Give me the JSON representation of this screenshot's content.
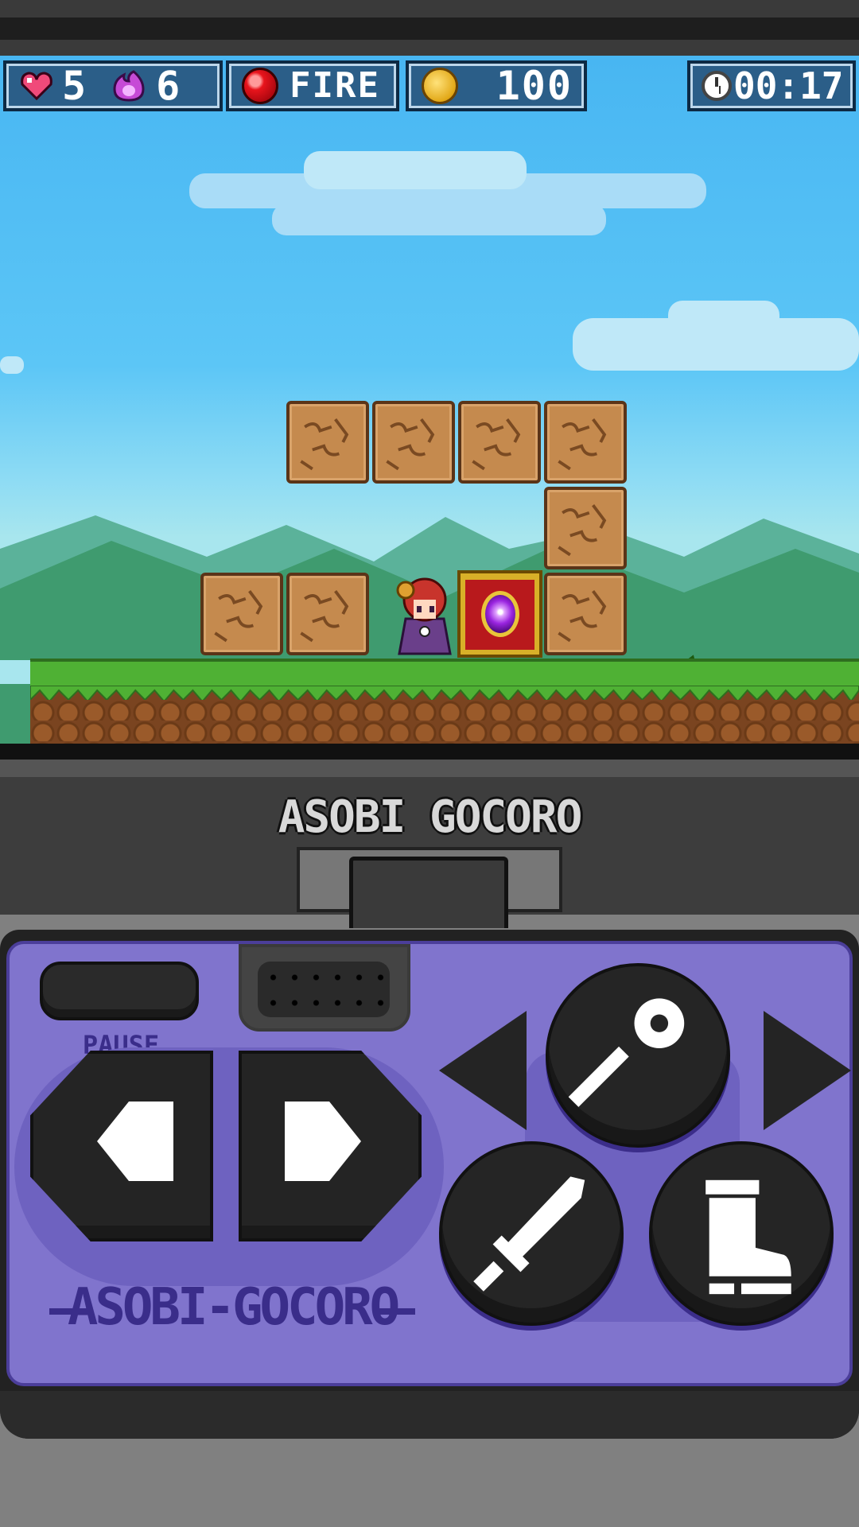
{
  "hud": {
    "lives": "5",
    "magic": "6",
    "element": "FIRE",
    "coins": "100",
    "timer": "00:17"
  },
  "device": {
    "brand_top": "ASOBI GOCORO",
    "brand_bottom": "ASOBI-GOCORO",
    "pause_label": "PAUSE"
  },
  "controls": {
    "dpad": [
      "left",
      "right"
    ],
    "camera": [
      "previous",
      "next"
    ],
    "actions": [
      "magic-staff",
      "sword-attack",
      "jump-boot"
    ]
  },
  "icons": [
    "heart-icon",
    "flame-icon",
    "fire-orb-icon",
    "coin-icon",
    "clock-icon",
    "staff-icon",
    "sword-icon",
    "boot-icon"
  ],
  "colors": {
    "hud_bg": "#2b5e88",
    "controller_face": "#8074cd",
    "brand_text": "#3a2d8a",
    "sky": "#48b6f2",
    "grass": "#4fb134"
  }
}
